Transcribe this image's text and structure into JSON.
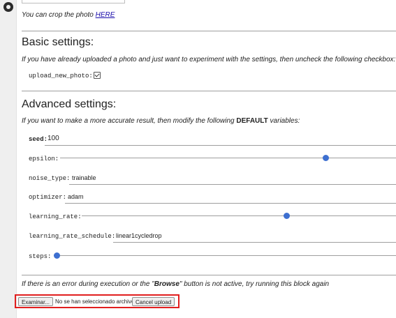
{
  "crop": {
    "text": "You can crop the photo",
    "link": "HERE"
  },
  "basic": {
    "title": "Basic settings:",
    "description": "If you have already uploaded a photo and just want to experiment with the settings, then uncheck the following checkbox:",
    "upload_label": "upload_new_photo:",
    "upload_checked": true
  },
  "advanced": {
    "title": "Advanced settings:",
    "description_pre": "If you want to make a more accurate result, then modify the following",
    "description_bold": "DEFAULT",
    "description_post": "variables:",
    "seed": {
      "label": "seed:",
      "value": "100"
    },
    "epsilon": {
      "label": "epsilon:",
      "level": 0.79
    },
    "noise_type": {
      "label": "noise_type:",
      "value": "trainable"
    },
    "optimizer": {
      "label": "optimizer:",
      "value": "adam"
    },
    "learning_rate": {
      "label": "learning_rate:",
      "level": 0.65
    },
    "learning_rate_schedule": {
      "label": "learning_rate_schedule:",
      "value": "linear1cycledrop"
    },
    "steps": {
      "label": "steps:",
      "level": 0.0
    }
  },
  "error_note": {
    "pre": "If there is an error during execution or the \"",
    "bold": "Browse",
    "post": "\" button is not active, try running this block again"
  },
  "upload": {
    "browse_label": "Examinar...",
    "no_file_text": "No se han seleccionado archivos.",
    "cancel_label": "Cancel upload",
    "highlight_color": "#e11e1e"
  },
  "colors": {
    "accent": "#3d6fd0"
  }
}
